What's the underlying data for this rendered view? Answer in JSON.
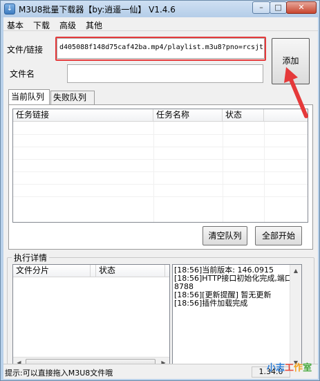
{
  "window": {
    "title": "M3U8批量下载器【by:逍遥一仙】 V1.4.6",
    "min_glyph": "–",
    "max_glyph": "□",
    "close_glyph": "✕"
  },
  "menu": [
    "基本",
    "下载",
    "高级",
    "其他"
  ],
  "form": {
    "link_label": "文件/链接",
    "link_value": "d405088f148d75caf42ba.mp4/playlist.m3u8?pno=rcsjt",
    "name_label": "文件名",
    "name_value": "",
    "add_button": "添加"
  },
  "tabs": [
    "当前队列",
    "失败队列"
  ],
  "task_columns": [
    "任务链接",
    "任务名称",
    "状态"
  ],
  "buttons": {
    "clear": "清空队列",
    "start_all": "全部开始"
  },
  "details": {
    "group_title": "执行详情",
    "file_columns": [
      "文件分片",
      "",
      "状态"
    ],
    "log_lines": [
      "[18:56]当前版本: 146.0915",
      "[18:56]HTTP接口初始化完成,端口: 8788",
      "[18:56][更新提醒] 暂无更新",
      "[18:56]插件加载完成"
    ]
  },
  "status": {
    "hint": "提示:可以直接拖入M3U8文件哦",
    "version": "1.34.0"
  },
  "watermark": {
    "text": "小志工作室",
    "colors": [
      "#2e7fd8",
      "#2e7fd8",
      "#e84a3a",
      "#f2a21b",
      "#44a83a"
    ]
  },
  "colors": {
    "highlight_box": "#e5393a",
    "arrow": "#e5393a"
  }
}
